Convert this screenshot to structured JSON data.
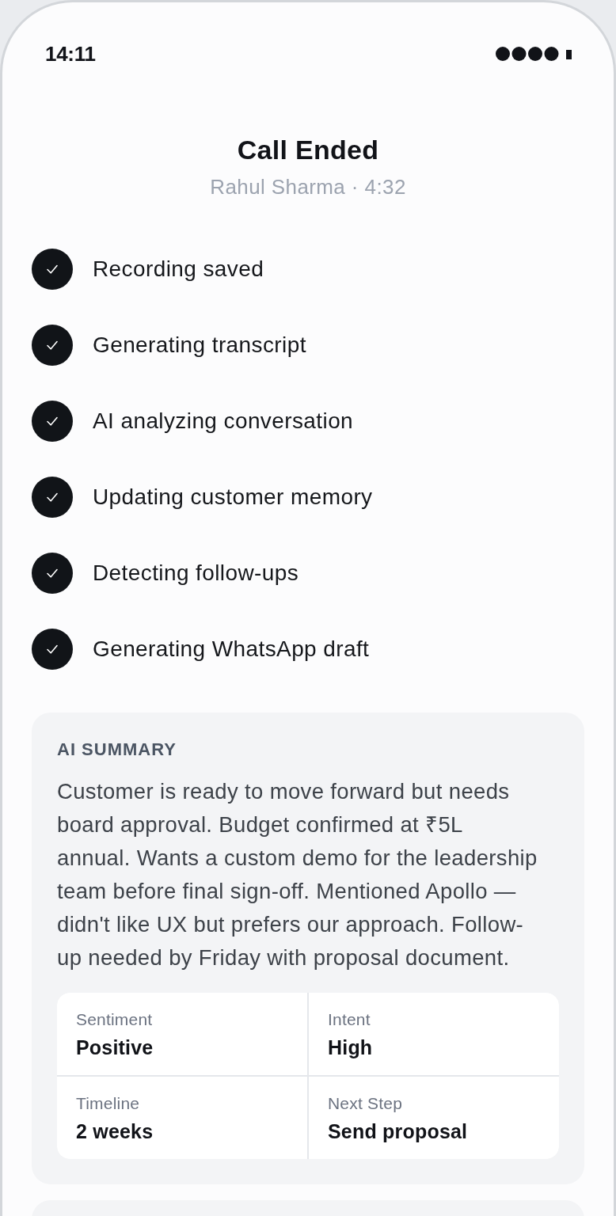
{
  "status_bar": {
    "time": "14:11"
  },
  "header": {
    "title": "Call Ended",
    "subtitle": "Rahul Sharma · 4:32"
  },
  "steps": [
    {
      "label": "Recording saved",
      "done": true
    },
    {
      "label": "Generating transcript",
      "done": true
    },
    {
      "label": "AI analyzing conversation",
      "done": true
    },
    {
      "label": "Updating customer memory",
      "done": true
    },
    {
      "label": "Detecting follow-ups",
      "done": true
    },
    {
      "label": "Generating WhatsApp draft",
      "done": true
    }
  ],
  "summary": {
    "heading": "AI SUMMARY",
    "text": "Customer is ready to move forward but needs board approval. Budget confirmed at ₹5L annual. Wants a custom demo for the leadership team before final sign-off. Mentioned Apollo — didn't like UX but prefers our approach. Follow-up needed by Friday with proposal document.",
    "metrics": [
      {
        "label": "Sentiment",
        "value": "Positive"
      },
      {
        "label": "Intent",
        "value": "High"
      },
      {
        "label": "Timeline",
        "value": "2 weeks"
      },
      {
        "label": "Next Step",
        "value": "Send proposal"
      }
    ]
  }
}
